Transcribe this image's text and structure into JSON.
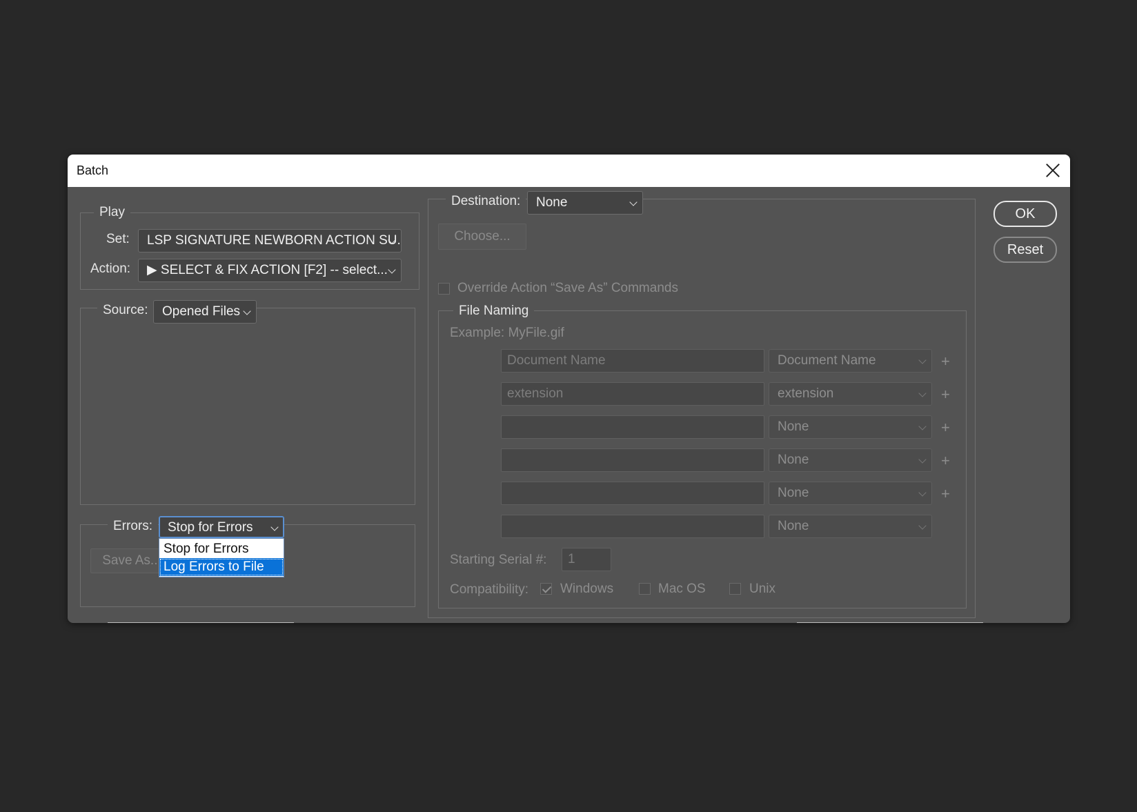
{
  "window": {
    "title": "Batch"
  },
  "play": {
    "legend": "Play",
    "set_label": "Set:",
    "set_value": "LSP SIGNATURE NEWBORN ACTION SU...",
    "action_label": "Action:",
    "action_value": "▶ SELECT & FIX ACTION  [F2] -- select..."
  },
  "source": {
    "label": "Source:",
    "value": "Opened Files"
  },
  "errors": {
    "label": "Errors:",
    "value": "Stop for Errors",
    "save_as_label": "Save As...",
    "options": [
      "Stop for Errors",
      "Log Errors to File"
    ],
    "highlighted_option": "Log Errors to File"
  },
  "destination": {
    "label": "Destination:",
    "value": "None",
    "choose_label": "Choose...",
    "override_label": "Override Action “Save As” Commands",
    "override_checked": false
  },
  "file_naming": {
    "legend": "File Naming",
    "example": "Example: MyFile.gif",
    "rows": [
      {
        "field": "Document Name",
        "select": "Document Name",
        "plus": "+"
      },
      {
        "field": "extension",
        "select": "extension",
        "plus": "+"
      },
      {
        "field": "",
        "select": "None",
        "plus": "+"
      },
      {
        "field": "",
        "select": "None",
        "plus": "+"
      },
      {
        "field": "",
        "select": "None",
        "plus": "+"
      },
      {
        "field": "",
        "select": "None",
        "plus": ""
      }
    ],
    "serial_label": "Starting Serial #:",
    "serial_value": "1",
    "compat_label": "Compatibility:",
    "compat": [
      {
        "label": "Windows",
        "checked": true
      },
      {
        "label": "Mac OS",
        "checked": false
      },
      {
        "label": "Unix",
        "checked": false
      }
    ]
  },
  "buttons": {
    "ok": "OK",
    "reset": "Reset"
  },
  "colors": {
    "background": "#282828",
    "dialog": "#535353",
    "highlight": "#0a72d8"
  },
  "icons": {
    "close": "close-icon",
    "dropdown": "chevron-down-icon",
    "add": "plus-icon"
  }
}
